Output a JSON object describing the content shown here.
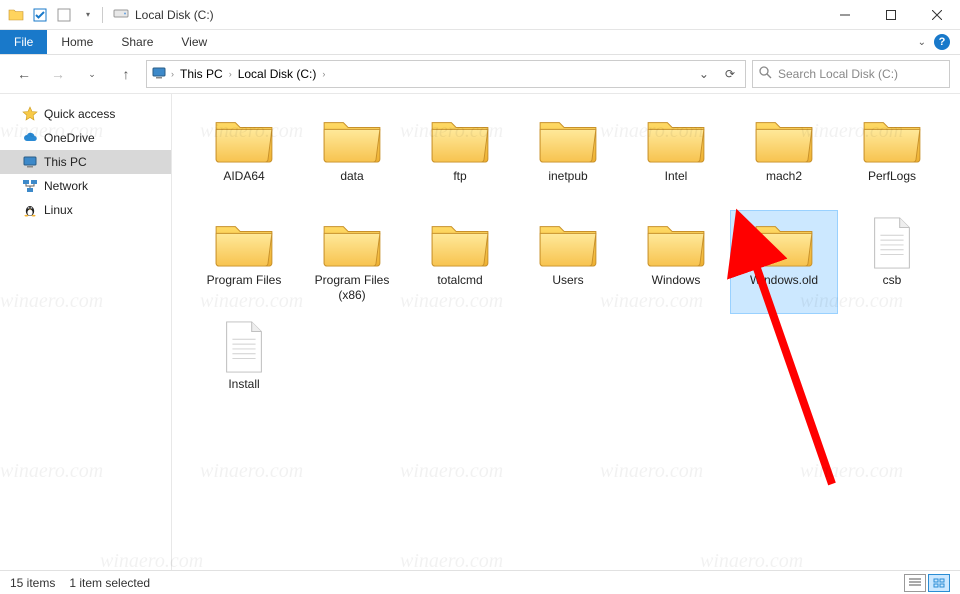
{
  "window": {
    "title": "Local Disk (C:)"
  },
  "ribbon": {
    "file": "File",
    "tabs": [
      "Home",
      "Share",
      "View"
    ]
  },
  "address": {
    "crumbs": [
      "This PC",
      "Local Disk (C:)"
    ]
  },
  "search": {
    "placeholder": "Search Local Disk (C:)"
  },
  "nav": {
    "items": [
      {
        "label": "Quick access",
        "icon": "star"
      },
      {
        "label": "OneDrive",
        "icon": "cloud"
      },
      {
        "label": "This PC",
        "icon": "pc",
        "selected": true
      },
      {
        "label": "Network",
        "icon": "network"
      },
      {
        "label": "Linux",
        "icon": "tux"
      }
    ]
  },
  "content": {
    "items": [
      {
        "name": "AIDA64",
        "type": "folder"
      },
      {
        "name": "data",
        "type": "folder"
      },
      {
        "name": "ftp",
        "type": "folder"
      },
      {
        "name": "inetpub",
        "type": "folder"
      },
      {
        "name": "Intel",
        "type": "folder"
      },
      {
        "name": "mach2",
        "type": "folder"
      },
      {
        "name": "PerfLogs",
        "type": "folder"
      },
      {
        "name": "Program Files",
        "type": "folder"
      },
      {
        "name": "Program Files (x86)",
        "type": "folder"
      },
      {
        "name": "totalcmd",
        "type": "folder"
      },
      {
        "name": "Users",
        "type": "folder"
      },
      {
        "name": "Windows",
        "type": "folder"
      },
      {
        "name": "Windows.old",
        "type": "folder",
        "selected": true
      },
      {
        "name": "csb",
        "type": "file"
      },
      {
        "name": "Install",
        "type": "file"
      }
    ]
  },
  "status": {
    "count": "15 items",
    "selected": "1 item selected"
  },
  "annotation": {
    "arrow_target": "Windows.old"
  },
  "watermark": "winaero.com"
}
